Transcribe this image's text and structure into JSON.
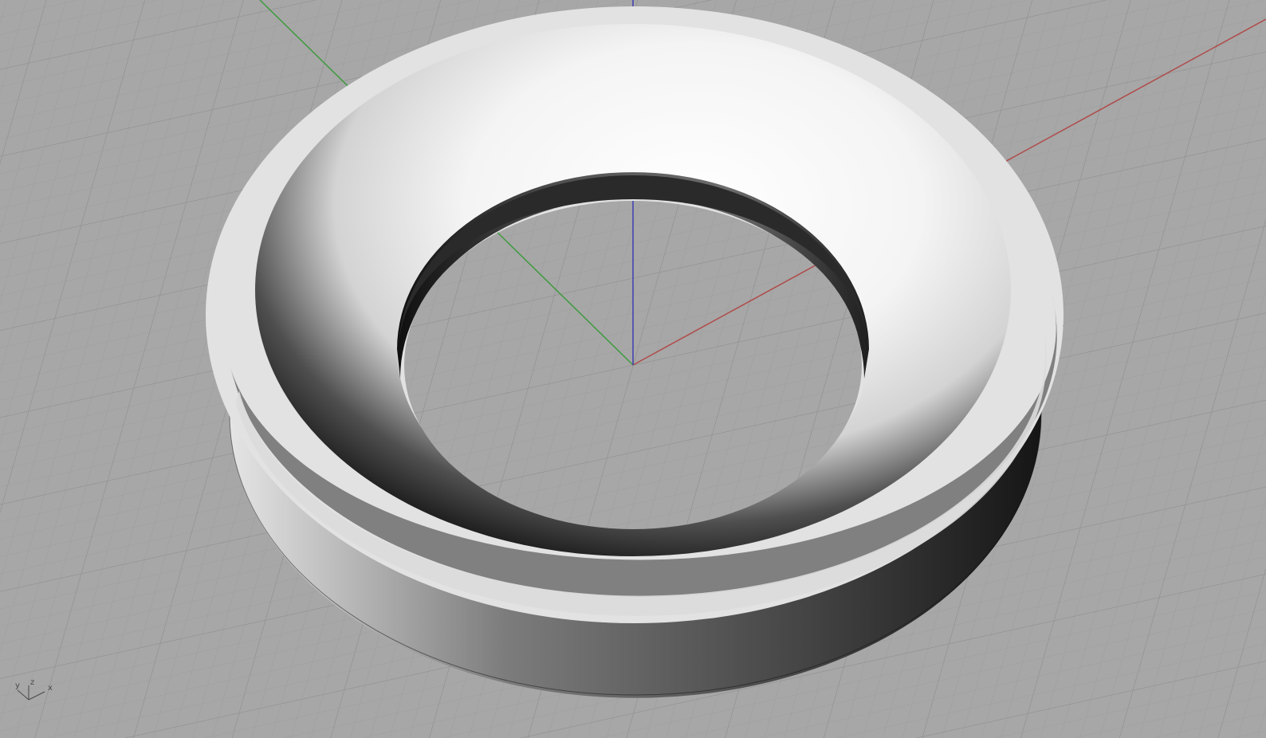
{
  "viewport": {
    "background": "#a7a7a7",
    "grid_minor_color": "#9d9d9d",
    "grid_major_color": "#8f8f8f",
    "axis_colors": {
      "x": "#b04a4a",
      "y": "#3f9a3f",
      "z": "#3f3fb0"
    }
  },
  "model": {
    "type": "ring-with-dish",
    "surface_light": "#f7f7f7",
    "surface_shadow": "#0e0e0e"
  },
  "gizmo": {
    "y_label": "y",
    "z_label": "z",
    "x_label": "x"
  }
}
